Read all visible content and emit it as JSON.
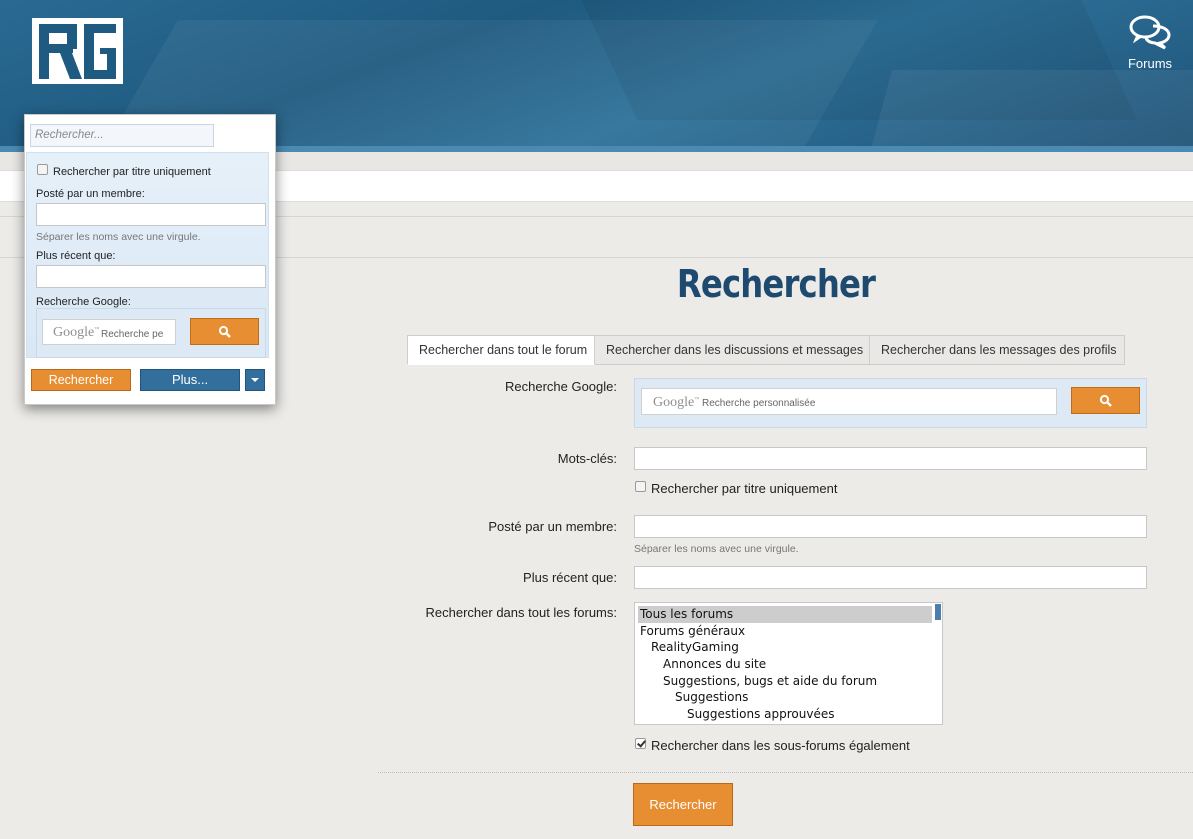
{
  "header": {
    "logo_text": "RG",
    "nav_forums_label": "Forums",
    "nav_forums_icon": "speech-bubbles-icon"
  },
  "popup": {
    "search_placeholder": "Rechercher...",
    "title_only_label": "Rechercher par titre uniquement",
    "posted_by_label": "Posté par un membre:",
    "separator_hint": "Séparer les noms avec une virgule.",
    "newer_than_label": "Plus récent que:",
    "google_label": "Recherche Google:",
    "google_logo": "Google",
    "google_tm": "™",
    "google_placeholder": "Recherche pe",
    "search_button": "Rechercher",
    "more_button": "Plus..."
  },
  "page": {
    "title": "Rechercher",
    "tabs": [
      {
        "label": "Rechercher dans tout le forum",
        "active": true
      },
      {
        "label": "Rechercher dans les discussions et messages",
        "active": false
      },
      {
        "label": "Rechercher dans les messages des profils",
        "active": false
      }
    ]
  },
  "form": {
    "google_label": "Recherche Google:",
    "google_logo": "Google",
    "google_tm": "™",
    "google_placeholder": "Recherche personnalisée",
    "keywords_label": "Mots-clés:",
    "title_only_label": "Rechercher par titre uniquement",
    "posted_by_label": "Posté par un membre:",
    "separator_hint": "Séparer les noms avec une virgule.",
    "newer_than_label": "Plus récent que:",
    "forums_label": "Rechercher dans tout les forums:",
    "forum_options": [
      {
        "label": "Tous les forums",
        "selected": true,
        "level": 0
      },
      {
        "label": "Forums généraux",
        "selected": false,
        "level": 0
      },
      {
        "label": "RealityGaming",
        "selected": false,
        "level": 1
      },
      {
        "label": "Annonces du site",
        "selected": false,
        "level": 2
      },
      {
        "label": "Suggestions, bugs et aide du forum",
        "selected": false,
        "level": 2
      },
      {
        "label": "Suggestions",
        "selected": false,
        "level": 3
      },
      {
        "label": "Suggestions approuvées",
        "selected": false,
        "level": 4
      }
    ],
    "subforums_label": "Rechercher dans les sous-forums également",
    "subforums_checked": true,
    "submit_button": "Rechercher"
  },
  "colors": {
    "header_blue": "#1f5a80",
    "accent_orange": "#e88e32",
    "title_blue": "#1e4a70",
    "button_blue": "#336f9c"
  }
}
